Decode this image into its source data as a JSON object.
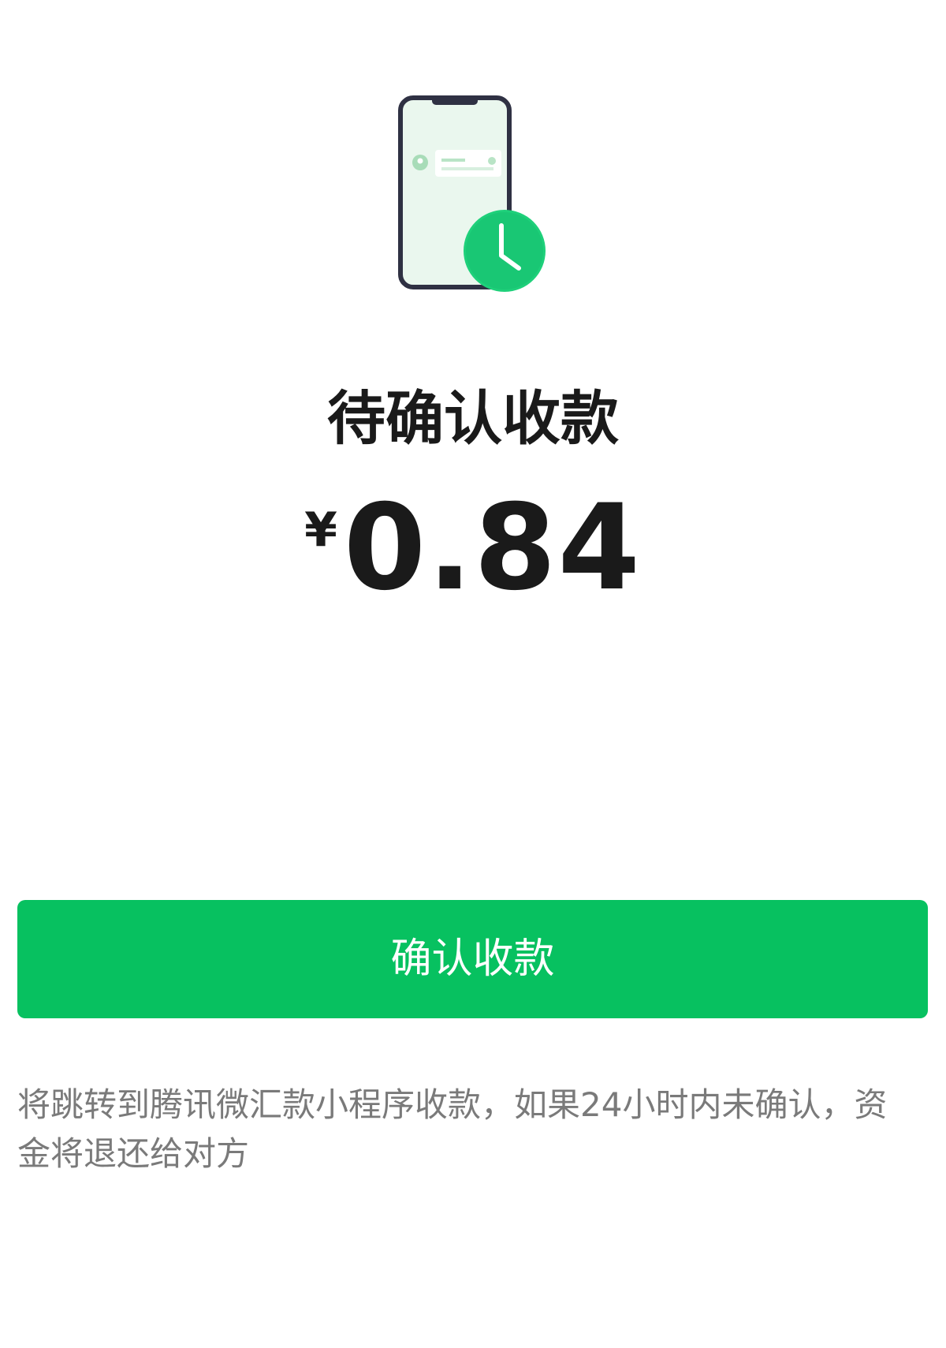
{
  "illustration": {
    "icon": "phone-pending-clock-icon",
    "accent_color": "#07c160"
  },
  "status": {
    "title": "待确认收款"
  },
  "amount": {
    "currency_symbol": "¥",
    "value": "0.84"
  },
  "actions": {
    "confirm_label": "确认收款",
    "confirm_color": "#07c160"
  },
  "notice": {
    "text": "将跳转到腾讯微汇款小程序收款，如果24小时内未确认，资金将退还给对方"
  }
}
